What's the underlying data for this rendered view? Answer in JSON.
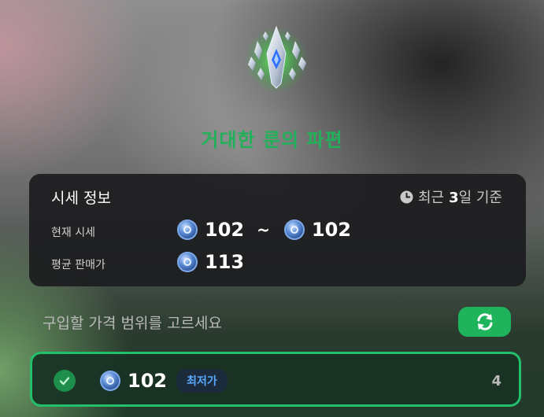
{
  "item": {
    "name": "거대한 룬의 파편"
  },
  "market_info": {
    "title": "시세 정보",
    "period_prefix": "최근",
    "period_value": "3",
    "period_suffix": "일 기준",
    "current_label": "현재 시세",
    "current_min": "102",
    "range_separator": "~",
    "current_max": "102",
    "average_label": "평균 판매가",
    "average_value": "113"
  },
  "purchase": {
    "prompt": "구입할 가격 범위를 고르세요",
    "refresh_icon": "refresh-icon"
  },
  "options": [
    {
      "price": "102",
      "badge": "최저가",
      "quantity": "4",
      "selected": true
    }
  ],
  "colors": {
    "accent": "#22b05a",
    "badge_text": "#59a9ff",
    "selected_border": "#22c06a"
  }
}
